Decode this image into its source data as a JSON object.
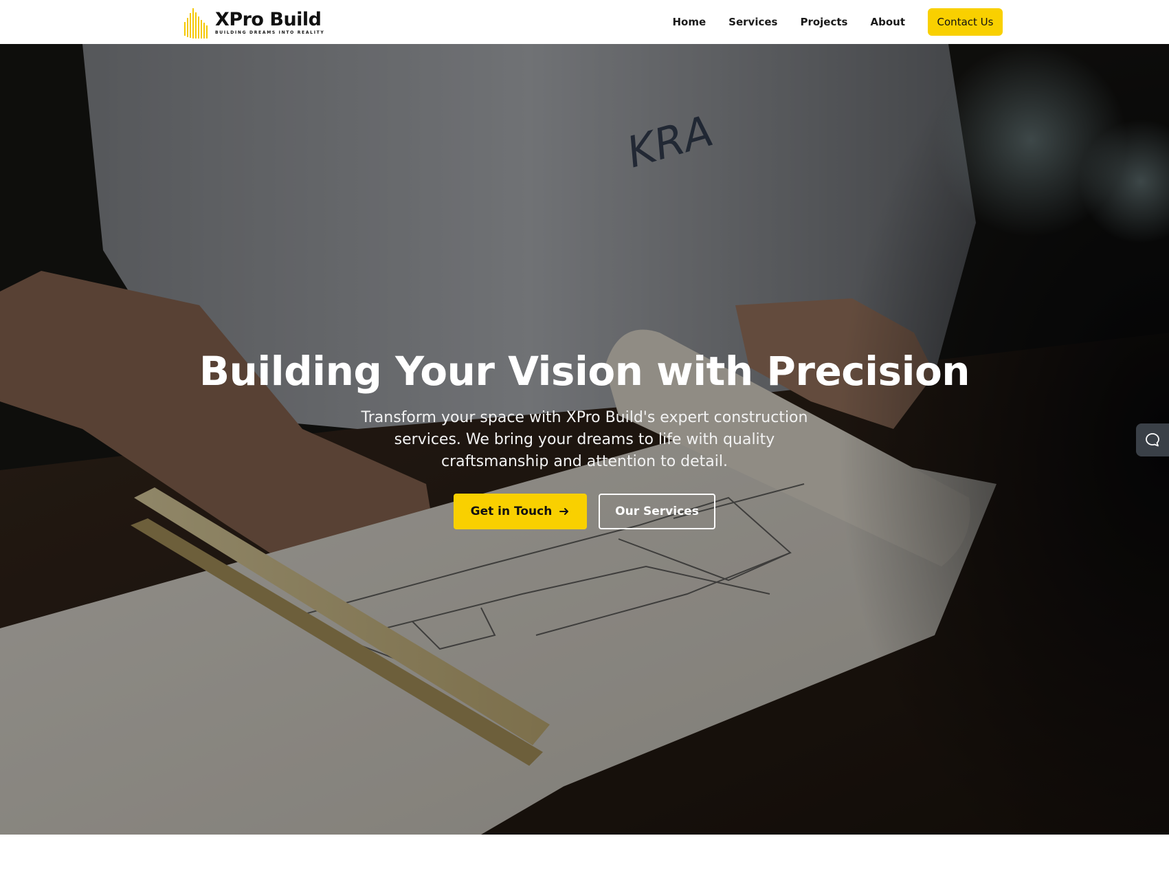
{
  "header": {
    "logo": {
      "name": "XPro Build",
      "tagline": "BUILDING DREAMS INTO REALITY",
      "icon": "building-bars-icon"
    },
    "nav": {
      "items": [
        {
          "label": "Home"
        },
        {
          "label": "Services"
        },
        {
          "label": "Projects"
        },
        {
          "label": "About"
        }
      ],
      "cta_label": "Contact Us"
    }
  },
  "hero": {
    "title": "Building Your Vision with Precision",
    "subtitle": "Transform your space with XPro Build's expert construction services. We bring your dreams to life with quality craftsmanship and attention to detail.",
    "primary_button": {
      "label": "Get in Touch",
      "icon": "arrow-right-icon"
    },
    "secondary_button": {
      "label": "Our Services"
    },
    "background": "man drafting blueprint with scale ruler on wooden desk"
  },
  "chat_widget": {
    "icon": "chat-bubble-icon"
  },
  "colors": {
    "accent": "#f9d000",
    "header_bg": "#ffffff",
    "text_dark": "#111111",
    "hero_text": "#ffffff",
    "chat_tab_bg": "#3a4047"
  }
}
